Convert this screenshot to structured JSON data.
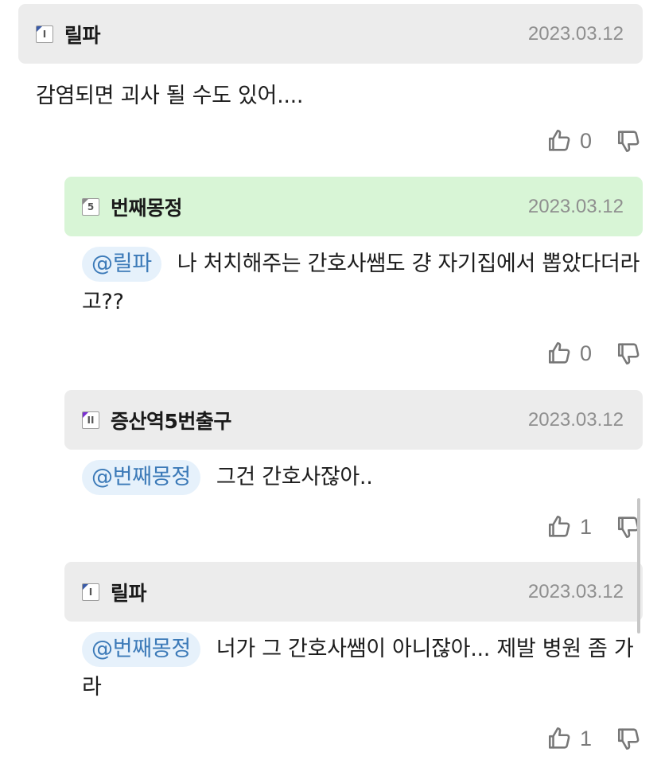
{
  "comments": [
    {
      "nickname": "릴파",
      "date": "2023.03.12",
      "level_icon": "level-badge",
      "level_glyph": "I",
      "text": "감염되면 괴사 될 수도 있어....",
      "likes": "0"
    },
    {
      "nickname": "번째몽정",
      "date": "2023.03.12",
      "level_icon": "level-badge",
      "level_glyph": "5",
      "mention": "@릴파",
      "text": "나 처치해주는 간호사쌤도 걍 자기집에서 뽑았다더라고??",
      "likes": "0"
    },
    {
      "nickname": "증산역5번출구",
      "date": "2023.03.12",
      "level_icon": "level-badge",
      "level_glyph": "II",
      "mention": "@번째몽정",
      "text": "그건 간호사잖아..",
      "likes": "1"
    },
    {
      "nickname": "릴파",
      "date": "2023.03.12",
      "level_icon": "level-badge",
      "level_glyph": "I",
      "mention": "@번째몽정",
      "text": "너가 그 간호사쌤이 아니잖아... 제발 병원 좀 가라",
      "likes": "1"
    }
  ],
  "colors": {
    "header_bg": "#ececec",
    "best_header_bg": "#d8f5d6",
    "mention_bg": "#e6f1fb",
    "mention_text": "#3c7ab8",
    "date_text": "#8f8f8f"
  },
  "icons": {
    "like": "thumbs-up-icon",
    "dislike": "thumbs-down-icon"
  }
}
